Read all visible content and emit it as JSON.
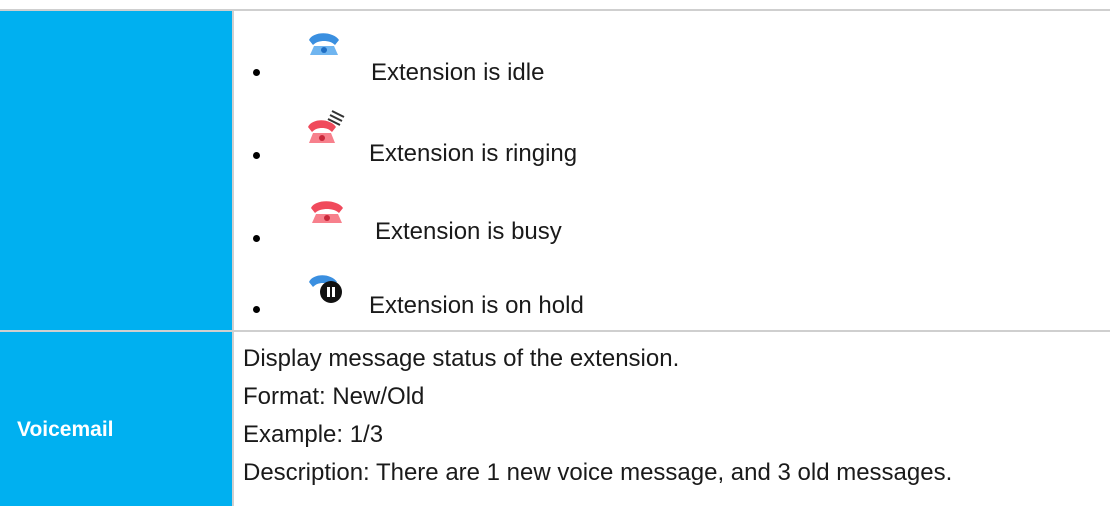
{
  "status_items": [
    {
      "icon": "phone-idle-icon",
      "color": "#3a8fe0",
      "text": "Extension is idle"
    },
    {
      "icon": "phone-ringing-icon",
      "color": "#f04a5c",
      "text": "Extension is ringing"
    },
    {
      "icon": "phone-busy-icon",
      "color": "#f04a5c",
      "text": "Extension is busy"
    },
    {
      "icon": "phone-hold-icon",
      "color": "#3a8fe0",
      "text": "Extension is on hold"
    }
  ],
  "voicemail": {
    "label": "Voicemail",
    "lines": [
      "Display message status of the extension.",
      "Format: New/Old",
      "Example: 1/3",
      "Description: There are 1 new voice message, and 3 old messages."
    ]
  },
  "colors": {
    "label_background": "#00B0F0",
    "border": "#cfcfcf",
    "label_text": "#ffffff"
  }
}
